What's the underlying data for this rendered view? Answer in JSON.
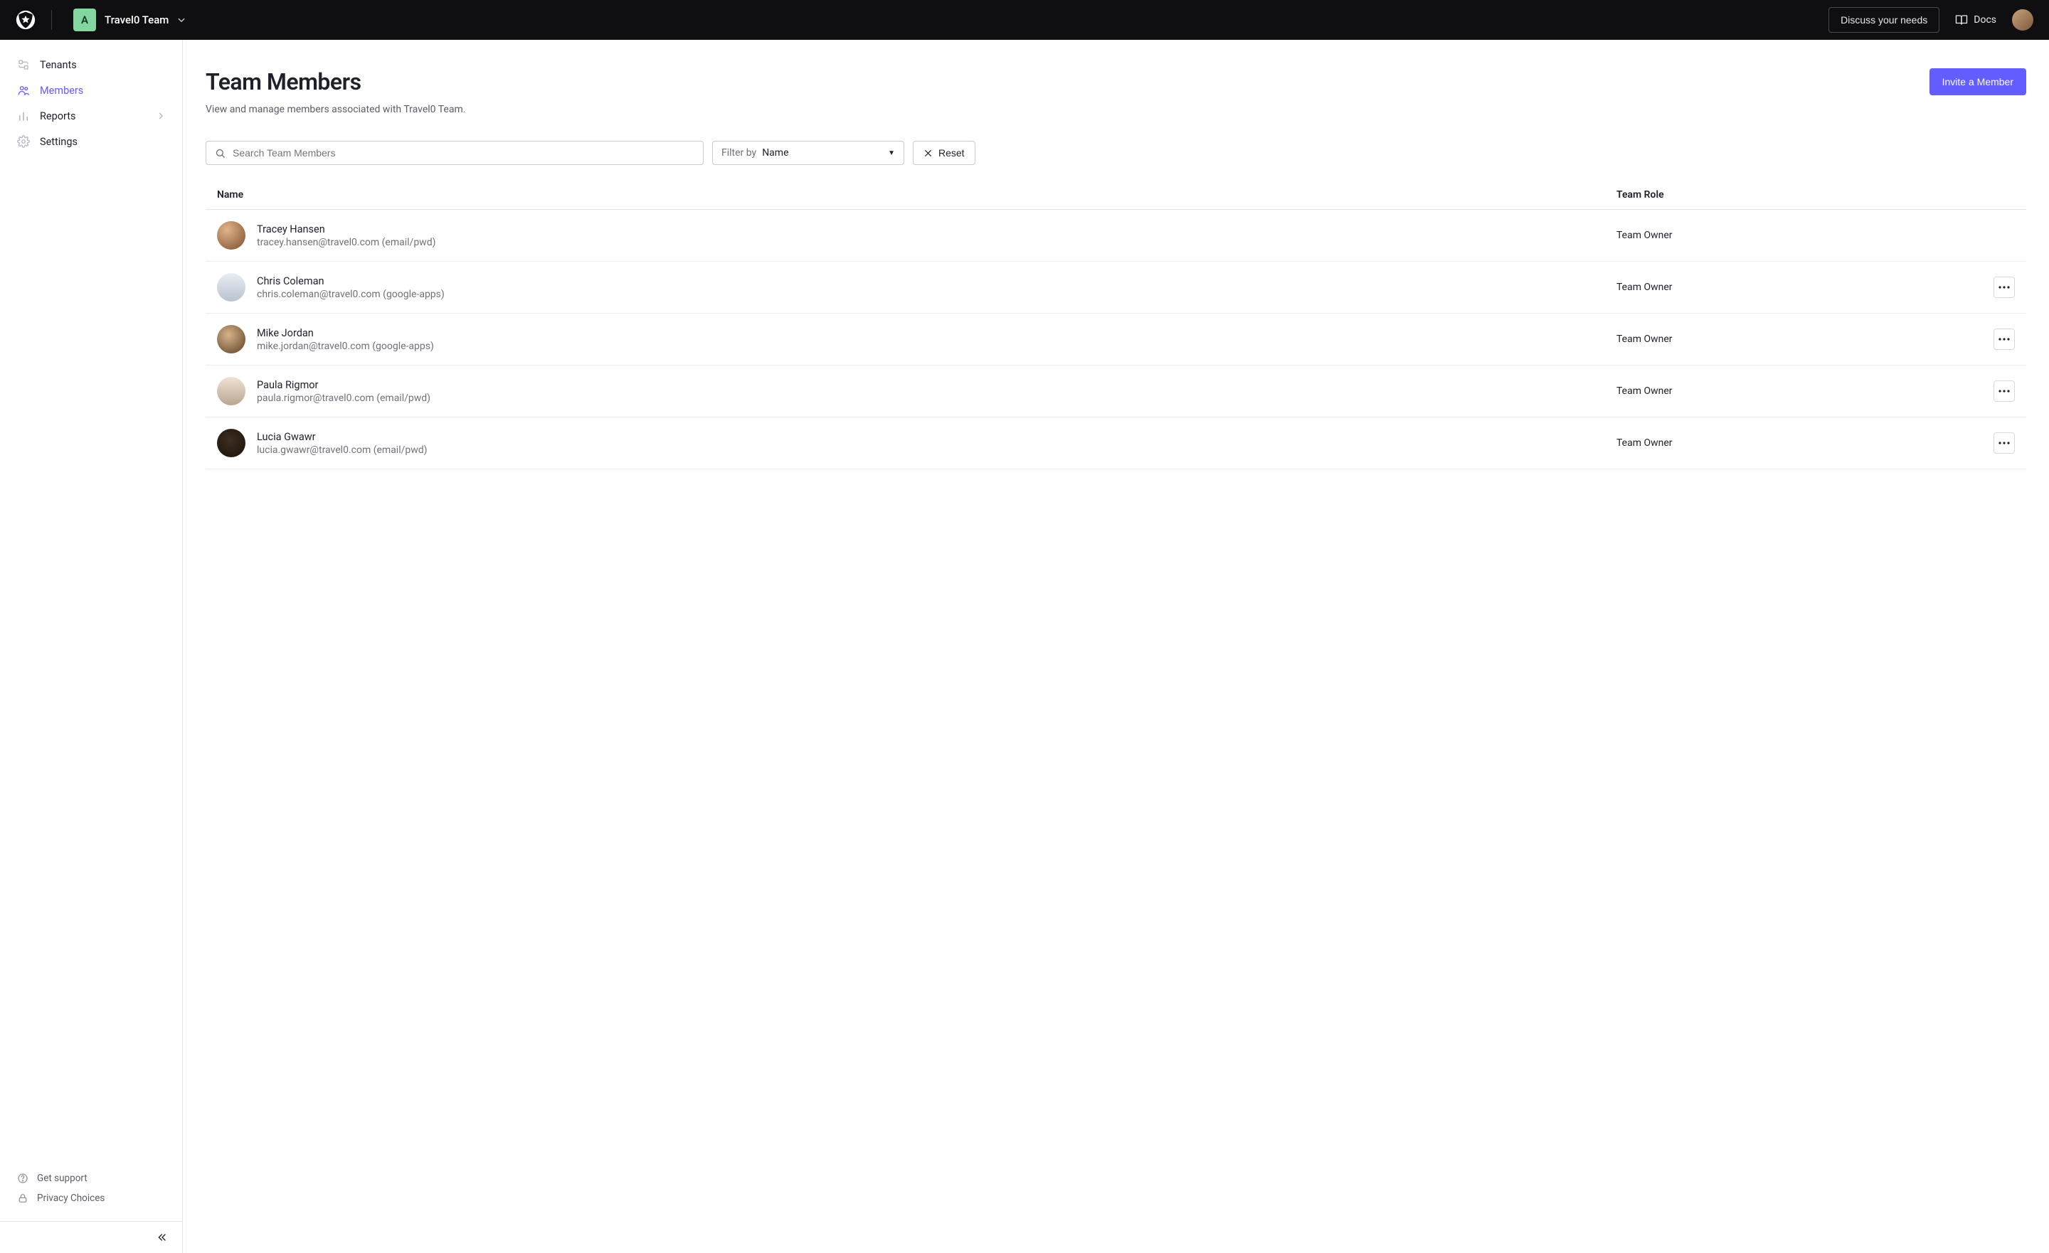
{
  "topbar": {
    "tenant_badge": "A",
    "tenant_name": "Travel0 Team",
    "discuss_label": "Discuss your needs",
    "docs_label": "Docs"
  },
  "sidebar": {
    "items": [
      {
        "label": "Tenants"
      },
      {
        "label": "Members"
      },
      {
        "label": "Reports"
      },
      {
        "label": "Settings"
      }
    ],
    "footer": {
      "support": "Get support",
      "privacy": "Privacy Choices"
    }
  },
  "page": {
    "title": "Team Members",
    "subtitle": "View and manage members associated with Travel0 Team.",
    "invite_label": "Invite a Member"
  },
  "controls": {
    "search_placeholder": "Search Team Members",
    "filter_label": "Filter by",
    "filter_value": "Name",
    "reset_label": "Reset"
  },
  "table": {
    "headers": {
      "name": "Name",
      "role": "Team Role"
    },
    "rows": [
      {
        "name": "Tracey Hansen",
        "detail": "tracey.hansen@travel0.com (email/pwd)",
        "role": "Team Owner",
        "actions": false
      },
      {
        "name": "Chris Coleman",
        "detail": "chris.coleman@travel0.com (google-apps)",
        "role": "Team Owner",
        "actions": true
      },
      {
        "name": "Mike Jordan",
        "detail": "mike.jordan@travel0.com (google-apps)",
        "role": "Team Owner",
        "actions": true
      },
      {
        "name": "Paula Rigmor",
        "detail": "paula.rigmor@travel0.com (email/pwd)",
        "role": "Team Owner",
        "actions": true
      },
      {
        "name": "Lucia Gwawr",
        "detail": "lucia.gwawr@travel0.com (email/pwd)",
        "role": "Team Owner",
        "actions": true
      }
    ]
  }
}
